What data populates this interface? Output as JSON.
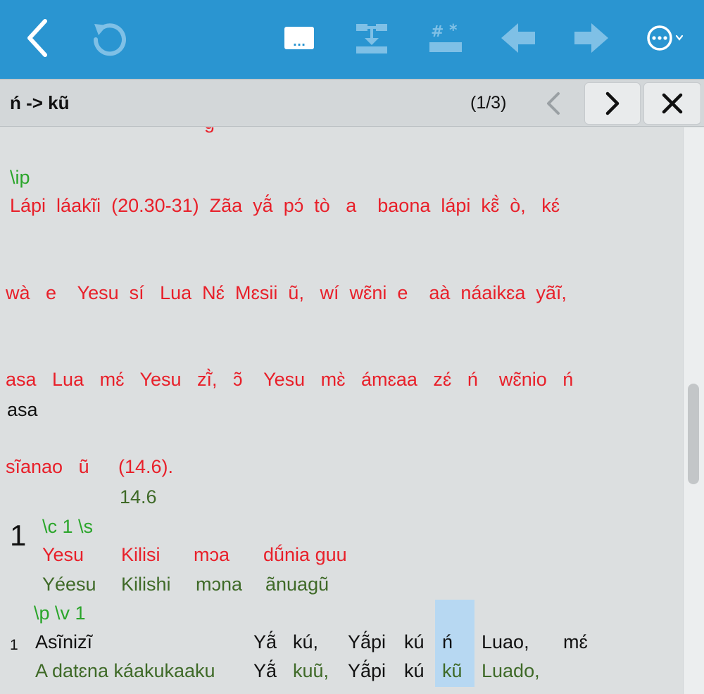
{
  "toolbar": {
    "buttons": [
      "back",
      "undo",
      "notes",
      "merge",
      "markers",
      "previous",
      "next",
      "more"
    ],
    "note_label": "...",
    "color": "#2a95d1"
  },
  "search": {
    "query": "ń -> kũ",
    "count": "(1/3)"
  },
  "content": {
    "partial_top_line": "g",
    "ip_marker": "\\ip",
    "ip_line1": "Lápi  láakĩi  (20.30-31)  Zãa  yã́  pɔ́  tò   a    baona  lápi  kɛ̃̀  ò,   kɛ́",
    "ip_line2": "wà   e    Yesu  sí   Lua  Nɛ́  Mɛsii  ũ,   wí  wɛ̃ni  e    aà  náaikɛa  yãĩ,",
    "ip_line3": "asa   Lua   mɛ́   Yesu   zĩ̀,   ɔ̃    Yesu   mɛ̀   ámɛaa   zɛ́   ń    wɛ̃nio   ń",
    "ip_line3_gloss": "asa",
    "ip_line4a": "sĩanao   ũ",
    "ip_line4b": "(14.6).",
    "ip_line4_gloss": "14.6",
    "chapter_number": "1",
    "chapter_marker": "\\c 1 \\s",
    "heading_words": [
      "Yesu",
      "Kilisi",
      "mɔa",
      "dṹnia guu"
    ],
    "heading_gloss": [
      "Yéesu",
      "Kilishi",
      "mɔna",
      "ãnuagũ"
    ],
    "para_marker": "\\p \\v 1",
    "verse_number": "1",
    "verse_words": [
      "Asĩnizĩ",
      "Yã́",
      "kú,",
      "Yã́pi",
      "kú",
      "ń",
      "Luao,",
      "mɛ́"
    ],
    "verse_gloss": [
      "A datɛna káakukaaku",
      "Yã́",
      "kuũ,",
      "Yã́pi",
      "kú",
      "kũ",
      "Luado,"
    ]
  },
  "colors": {
    "source_text": "#e8202a",
    "marker": "#2aa52a",
    "gloss": "#3f6a28",
    "highlight": "#b7d8f2"
  }
}
